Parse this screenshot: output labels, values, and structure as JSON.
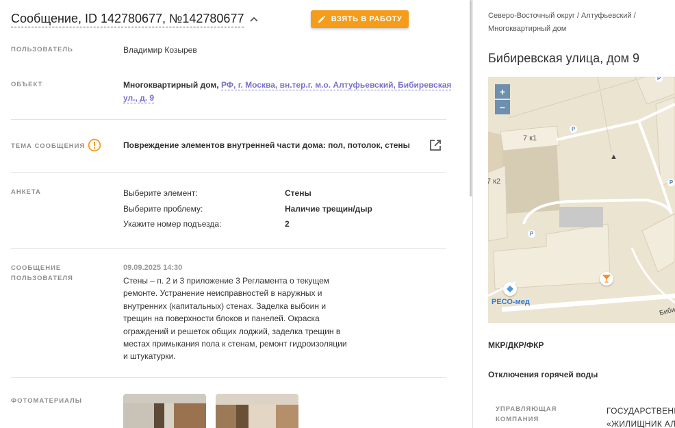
{
  "header": {
    "title": "Сообщение, ID 142780677, №142780677",
    "take_button_label": "ВЗЯТЬ В РАБОТУ"
  },
  "fields": {
    "user_label": "ПОЛЬЗОВАТЕЛЬ",
    "user_value": "Владимир Козырев",
    "object_label": "ОБЪЕКТ",
    "object_type": "Многоквартирный дом,",
    "object_address_line1": "РФ, г. Москва, вн.тер.г. м.о. Алтуфьевский, Бибиревская",
    "object_address_line2": "ул., д. 9",
    "topic_label": "ТЕМА СООБЩЕНИЯ",
    "topic_value": "Повреждение элементов внутренней части дома: пол, потолок, стены",
    "survey_label": "АНКЕТА",
    "survey": [
      {
        "question": "Выберите элемент:",
        "answer": "Стены"
      },
      {
        "question": "Выберите проблему:",
        "answer": "Наличие трещин/дыр"
      },
      {
        "question": "Укажите номер подъезда:",
        "answer": "2"
      }
    ],
    "message_label_line1": "СООБЩЕНИЕ",
    "message_label_line2": "ПОЛЬЗОВАТЕЛЯ",
    "message_date": "09.09.2025 14:30",
    "message_lines": [
      "Стены – п. 2 и 3 приложение 3 Регламента о текущем",
      "ремонте. Устранение неисправностей в наружных и",
      "внутренних (капитальных) стенах. Заделка выбоин и",
      "трещин на поверхности блоков и панелей. Окраска",
      "ограждений и решеток общих лоджий, заделка трещин в",
      "местах примыкания пола к стенам, ремонт гидроизоляции",
      "и штукатурки."
    ],
    "photos_label": "ФОТОМАТЕРИАЛЫ"
  },
  "sidebar": {
    "breadcrumb_line1": "Северо-Восточный округ / Алтуфьевский /",
    "breadcrumb_line2": "Многоквартирный дом",
    "address_title": "Бибиревская улица, дом 9",
    "map": {
      "zoom_in": "+",
      "zoom_out": "−",
      "label_building_1": "7 к1",
      "label_building_2": "7 к2",
      "label_poi": "РЕСО-мед",
      "label_street": "Бибир",
      "parking_sign": "P"
    },
    "programs_label": "МКР/ДКР/ФКР",
    "hot_water_label": "Отключения горячей воды",
    "org_label_line1": "УПРАВЛЯЮЩАЯ",
    "org_label_line2": "КОМПАНИЯ",
    "org_value_line1": "ГОСУДАРСТВЕНН",
    "org_value_line2": "«ЖИЛИЩНИК АЛ"
  },
  "colors": {
    "accent_orange": "#f59c1a",
    "link_purple": "#7a70c7",
    "label_gray": "#8e8e8e"
  },
  "icons": [
    "chevron-up-icon",
    "pencil-icon",
    "warning-icon",
    "external-link-icon",
    "parking-icon",
    "pharmacy-icon",
    "poi-icon"
  ]
}
